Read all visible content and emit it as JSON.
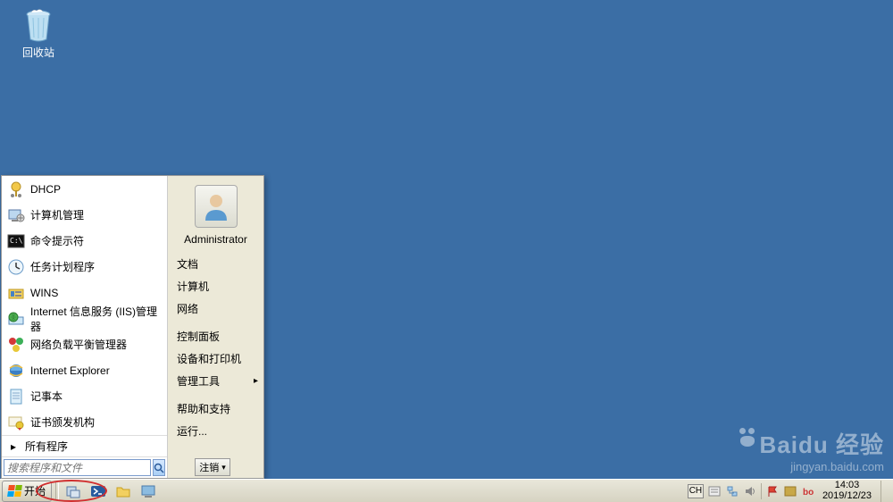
{
  "desktop": {
    "recycle_label": "回收站"
  },
  "start_menu": {
    "programs": [
      {
        "label": "DHCP",
        "icon": "dhcp"
      },
      {
        "label": "计算机管理",
        "icon": "computer-mgmt"
      },
      {
        "label": "命令提示符",
        "icon": "cmd"
      },
      {
        "label": "任务计划程序",
        "icon": "task-sched"
      },
      {
        "label": "WINS",
        "icon": "wins"
      },
      {
        "label": "Internet 信息服务 (IIS)管理器",
        "icon": "iis"
      },
      {
        "label": "网络负载平衡管理器",
        "icon": "nlb"
      },
      {
        "label": "Internet Explorer",
        "icon": "ie"
      },
      {
        "label": "记事本",
        "icon": "notepad"
      },
      {
        "label": "证书颁发机构",
        "icon": "cert"
      }
    ],
    "all_programs": "所有程序",
    "search_placeholder": "搜索程序和文件",
    "user_name": "Administrator",
    "right_links": [
      {
        "label": "文档",
        "has_sub": false
      },
      {
        "label": "计算机",
        "has_sub": false
      },
      {
        "label": "网络",
        "has_sub": false
      },
      {
        "label": "控制面板",
        "has_sub": false
      },
      {
        "label": "设备和打印机",
        "has_sub": false
      },
      {
        "label": "管理工具",
        "has_sub": true
      },
      {
        "label": "帮助和支持",
        "has_sub": false
      },
      {
        "label": "运行...",
        "has_sub": false
      }
    ],
    "logoff_label": "注销"
  },
  "taskbar": {
    "start_label": "开始",
    "lang": "CH",
    "time": "14:03",
    "date": "2019/12/23"
  },
  "watermark": {
    "brand": "Baidu 经验",
    "url": "jingyan.baidu.com"
  }
}
